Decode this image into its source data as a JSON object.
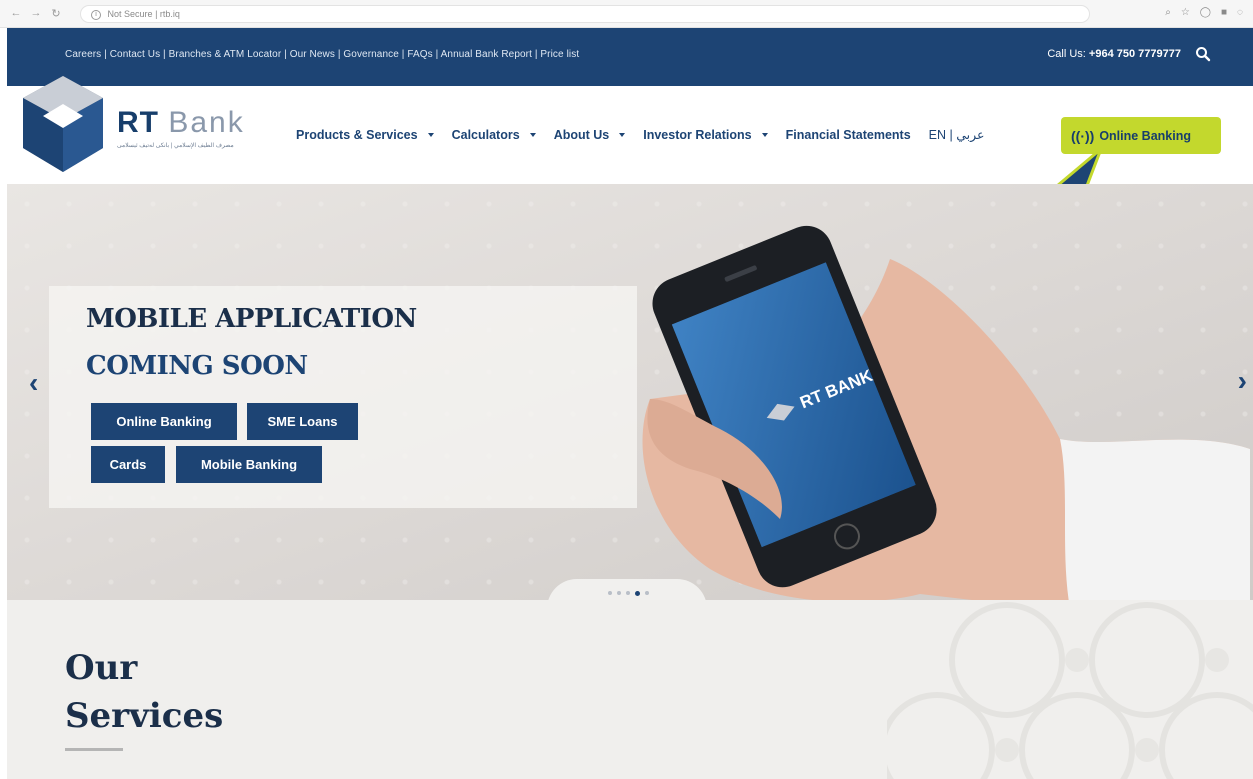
{
  "browser": {
    "address_security": "Not Secure",
    "address_url": "rtb.iq"
  },
  "topbar": {
    "links": "Careers | Contact Us | Branches & ATM Locator | Our News | Governance | FAQs | Annual Bank Report | Price list",
    "call_label": "Call Us:",
    "call_number": "+964 750 7779777"
  },
  "header": {
    "brand_bold": "RT",
    "brand_light": "Bank",
    "tagline": "مصرف الطيف الإسلامي | بانكی لەتیف ئیسلامی",
    "menu": [
      {
        "label": "Products & Services"
      },
      {
        "label": "Calculators"
      },
      {
        "label": "About Us"
      },
      {
        "label": "Investor Relations"
      },
      {
        "label": "Financial Statements"
      }
    ],
    "lang": "EN | عربي",
    "online_banking": "Online Banking",
    "online_banking_icon": "((·))"
  },
  "hero": {
    "heading": "MOBILE APPLICATION",
    "subheading": "COMING SOON",
    "buttons": [
      "Online Banking",
      "SME Loans",
      "Cards",
      "Mobile Banking"
    ],
    "phone_brand": "RT BANK",
    "prev_glyph": "‹",
    "next_glyph": "›",
    "slides": 5,
    "active_slide": 4
  },
  "services": {
    "title_line1": "Our",
    "title_line2": "Services"
  },
  "colors": {
    "primary": "#1d4474",
    "accent": "#c3d82d"
  }
}
